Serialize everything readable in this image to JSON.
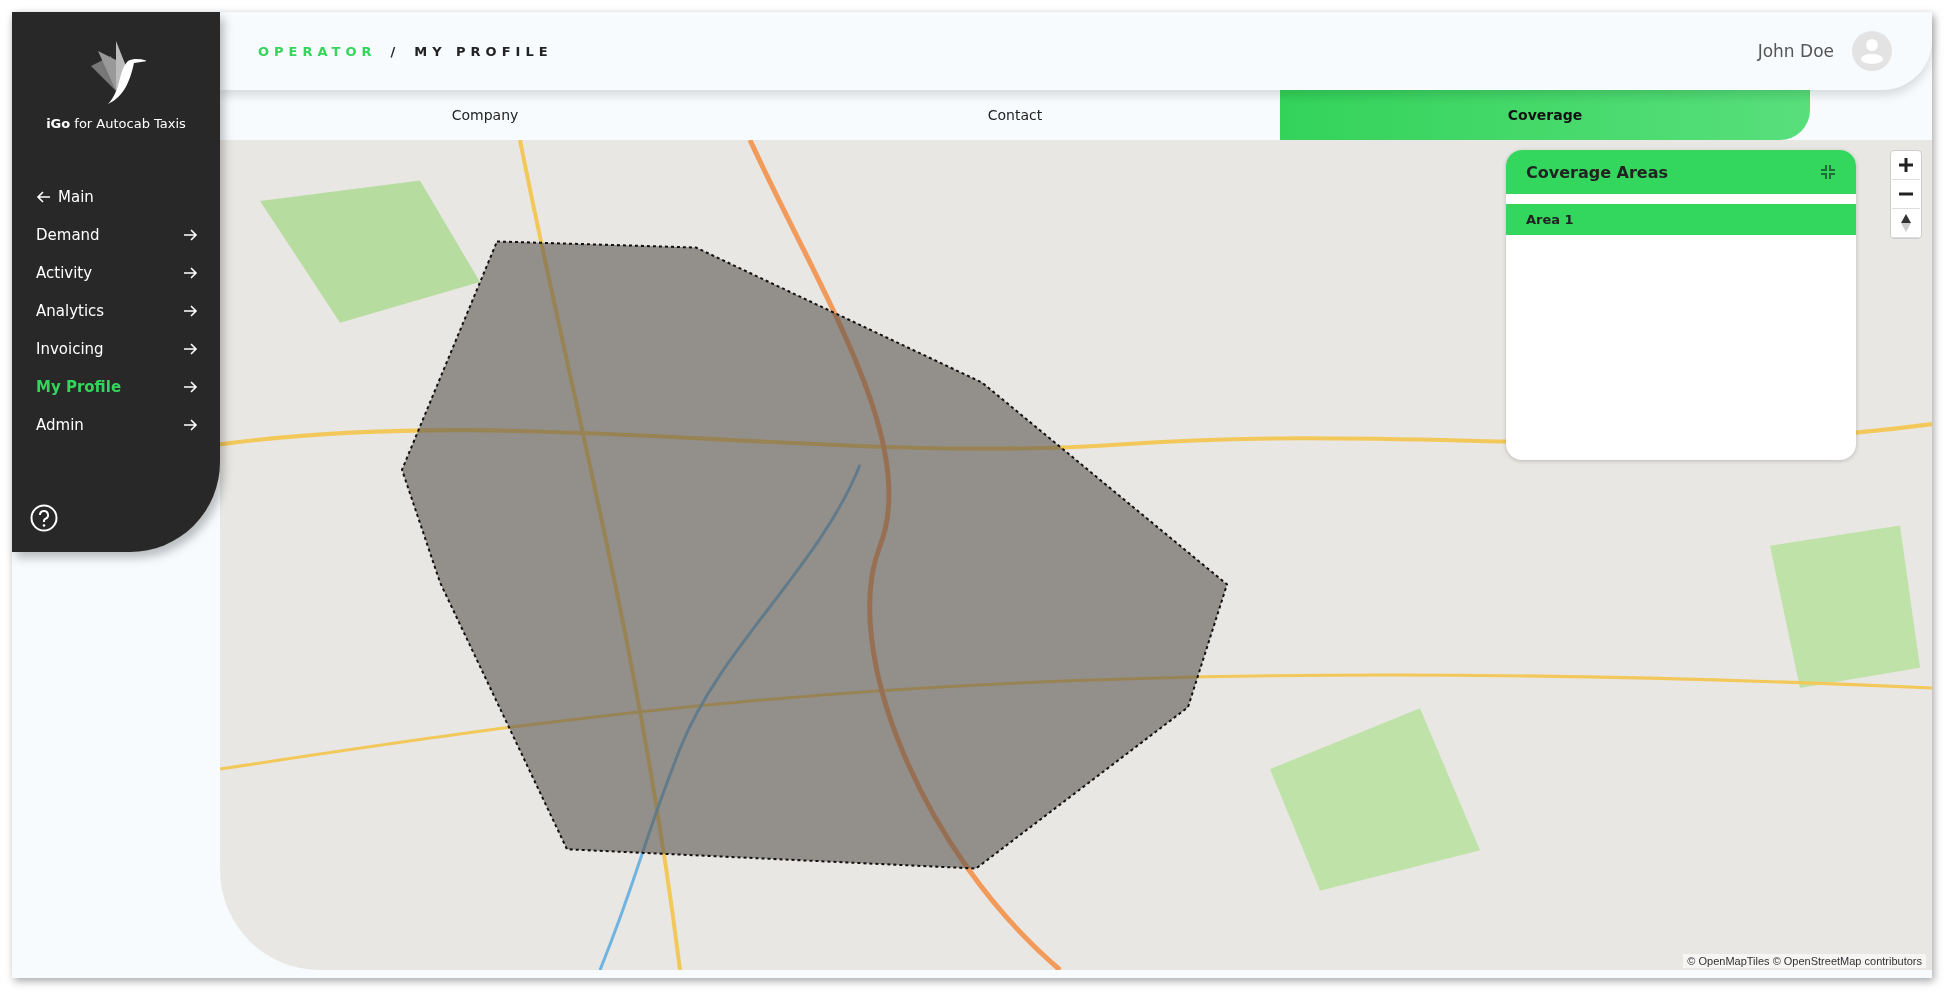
{
  "sidebar": {
    "brand": "**iGo** for Autocab Taxis",
    "back": {
      "label": "Main"
    },
    "items": [
      {
        "label": "Demand",
        "selected": false
      },
      {
        "label": "Activity",
        "selected": false
      },
      {
        "label": "Analytics",
        "selected": false
      },
      {
        "label": "Invoicing",
        "selected": false
      },
      {
        "label": "My Profile",
        "selected": true
      },
      {
        "label": "Admin",
        "selected": false
      }
    ]
  },
  "header": {
    "breadcrumb": {
      "section": "OPERATOR",
      "separator": "/",
      "page": "MY PROFILE"
    },
    "user": {
      "name": "John Doe"
    }
  },
  "tabs": [
    {
      "label": "Company",
      "selected": false
    },
    {
      "label": "Contact",
      "selected": false
    },
    {
      "label": "Coverage",
      "selected": true
    }
  ],
  "panel": {
    "title": "Coverage Areas",
    "areas": [
      {
        "label": "Area 1",
        "selected": true
      }
    ]
  },
  "map": {
    "attribution": "© OpenMapTiles © OpenStreetMap contributors"
  }
}
